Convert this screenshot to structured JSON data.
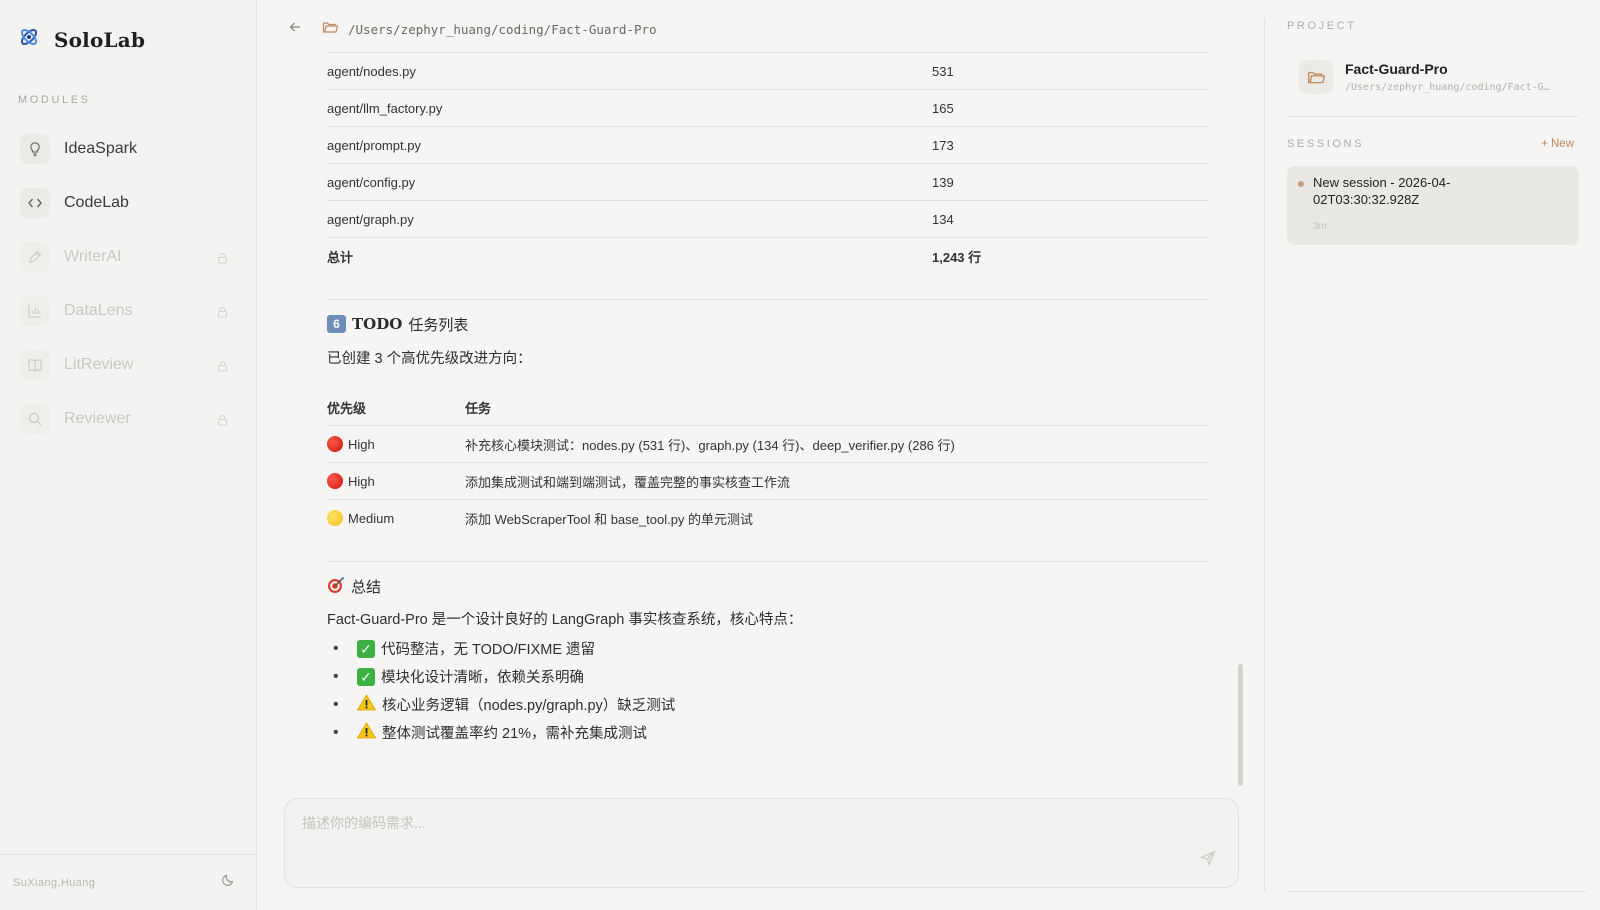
{
  "app": {
    "name": "SoloLab"
  },
  "sidebar": {
    "modules_title": "MODULES",
    "items": [
      {
        "label": "IdeaSpark",
        "icon": "lightbulb-icon",
        "locked": false
      },
      {
        "label": "CodeLab",
        "icon": "code-icon",
        "locked": false
      },
      {
        "label": "WriterAI",
        "icon": "pen-icon",
        "locked": true
      },
      {
        "label": "DataLens",
        "icon": "bar-chart-icon",
        "locked": true
      },
      {
        "label": "LitReview",
        "icon": "book-icon",
        "locked": true
      },
      {
        "label": "Reviewer",
        "icon": "search-icon",
        "locked": true
      }
    ],
    "user": "SuXiang.Huang"
  },
  "main": {
    "path": "/Users/zephyr_huang/coding/Fact-Guard-Pro",
    "line_counts": [
      {
        "file": "agent/nodes.py",
        "lines": "531"
      },
      {
        "file": "agent/llm_factory.py",
        "lines": "165"
      },
      {
        "file": "agent/prompt.py",
        "lines": "173"
      },
      {
        "file": "agent/config.py",
        "lines": "139"
      },
      {
        "file": "agent/graph.py",
        "lines": "134"
      }
    ],
    "total": {
      "label": "总计",
      "value": "1,243 行"
    },
    "todo_section": {
      "number": "6",
      "title_en": "TODO",
      "title_zh": "任务列表",
      "intro": "已创建 3 个高优先级改进方向：",
      "headers": {
        "priority": "优先级",
        "task": "任务"
      },
      "rows": [
        {
          "priority": "High",
          "color": "#d9261c",
          "task": "补充核心模块测试：nodes.py (531 行)、graph.py (134 行)、deep_verifier.py (286 行)"
        },
        {
          "priority": "High",
          "color": "#d9261c",
          "task": "添加集成测试和端到端测试，覆盖完整的事实核查工作流"
        },
        {
          "priority": "Medium",
          "color": "#f5c518",
          "task": "添加 WebScraperTool 和 base_tool.py 的单元测试"
        }
      ]
    },
    "summary_section": {
      "title": "总结",
      "intro": "Fact-Guard-Pro 是一个设计良好的 LangGraph 事实核查系统，核心特点：",
      "bullets": [
        {
          "icon": "check",
          "text": "代码整洁，无 TODO/FIXME 遗留"
        },
        {
          "icon": "check",
          "text": "模块化设计清晰，依赖关系明确"
        },
        {
          "icon": "warning",
          "text": "核心业务逻辑（nodes.py/graph.py）缺乏测试"
        },
        {
          "icon": "warning",
          "text": "整体测试覆盖率约 21%，需补充集成测试"
        }
      ]
    },
    "composer": {
      "placeholder": "描述你的编码需求..."
    }
  },
  "right_panel": {
    "project_title": "PROJECT",
    "project": {
      "name": "Fact-Guard-Pro",
      "path": "/Users/zephyr_huang/coding/Fact-Guard-Pro"
    },
    "sessions_title": "SESSIONS",
    "new_label": "+ New",
    "sessions": [
      {
        "title": "New session - 2026-04-02T03:30:32.928Z",
        "age": "3m"
      }
    ]
  },
  "colors": {
    "accent": "#c08a5a",
    "background": "#f6f5f3",
    "session_bg": "#e9e8e5"
  }
}
